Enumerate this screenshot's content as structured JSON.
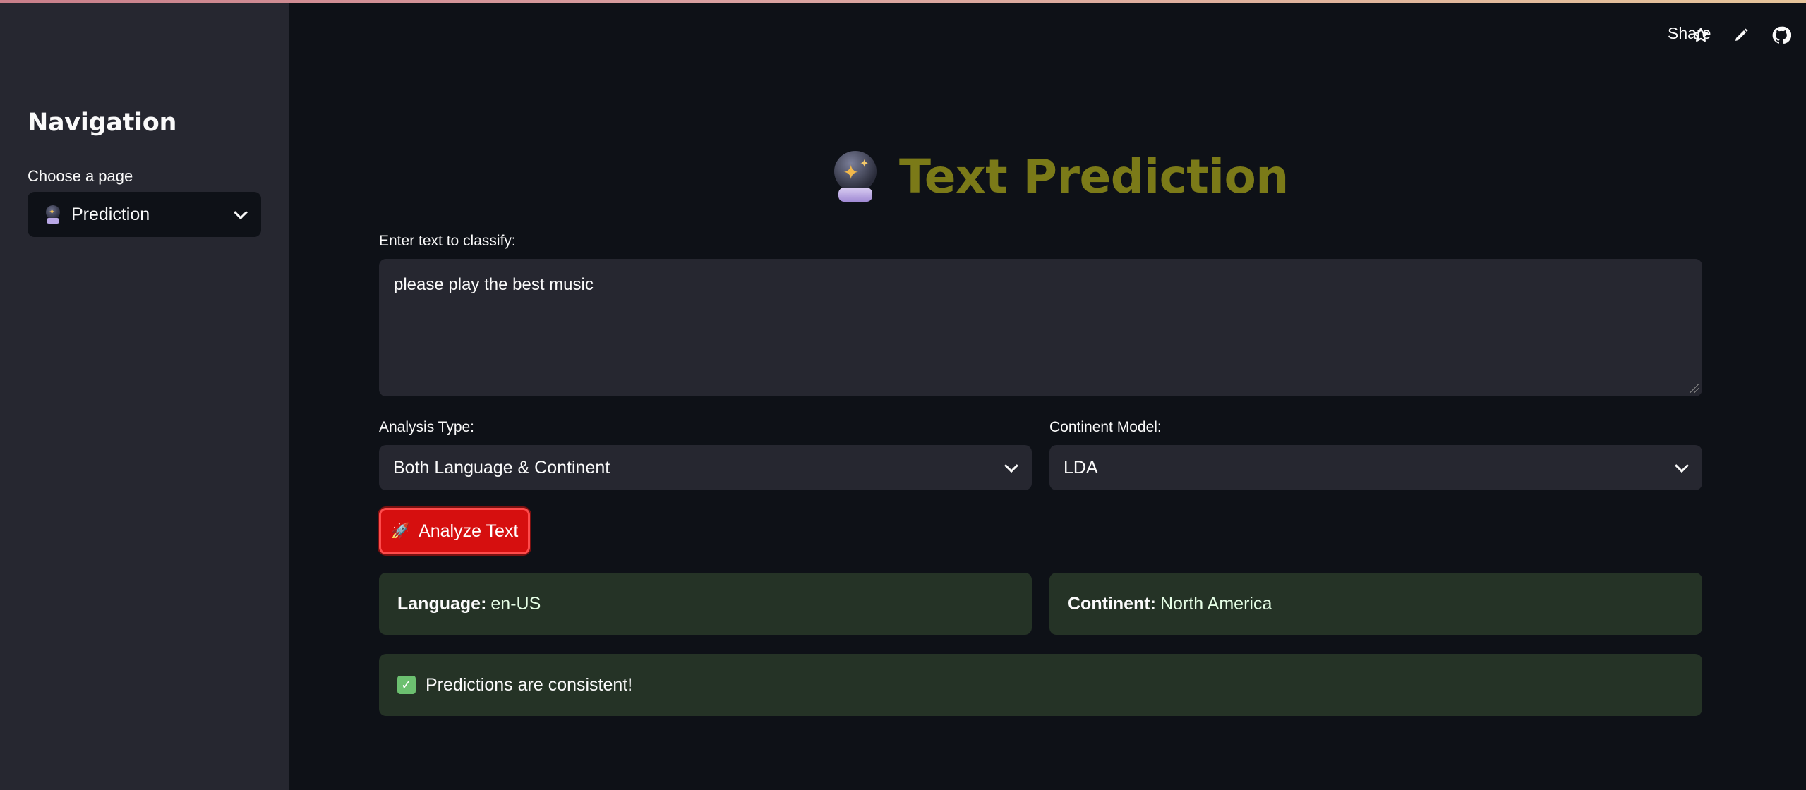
{
  "sidebar": {
    "heading": "Navigation",
    "page_select_label": "Choose a page",
    "page_select_value": "Prediction",
    "page_select_icon": "crystal-ball-icon"
  },
  "toolbar": {
    "share_label": "Share",
    "icons": [
      "star-icon",
      "edit-pencil-icon",
      "github-icon",
      "more-vert-icon"
    ]
  },
  "main": {
    "title": "Text Prediction",
    "title_icon": "crystal-ball-icon",
    "title_color": "#7b7a18",
    "text_input_label": "Enter text to classify:",
    "text_input_value": "please play the best music",
    "analysis_type_label": "Analysis Type:",
    "analysis_type_value": "Both Language & Continent",
    "continent_model_label": "Continent Model:",
    "continent_model_value": "LDA",
    "analyze_button_label": "Analyze Text",
    "analyze_button_icon": "rocket-icon",
    "analyze_button_color": "#d60f0f",
    "results": {
      "language_label": "Language:",
      "language_value": "en-US",
      "continent_label": "Continent:",
      "continent_value": "North America",
      "consistency_message": "Predictions are consistent!",
      "consistency_icon": "check-mark-icon",
      "success_color": "#253326"
    }
  }
}
